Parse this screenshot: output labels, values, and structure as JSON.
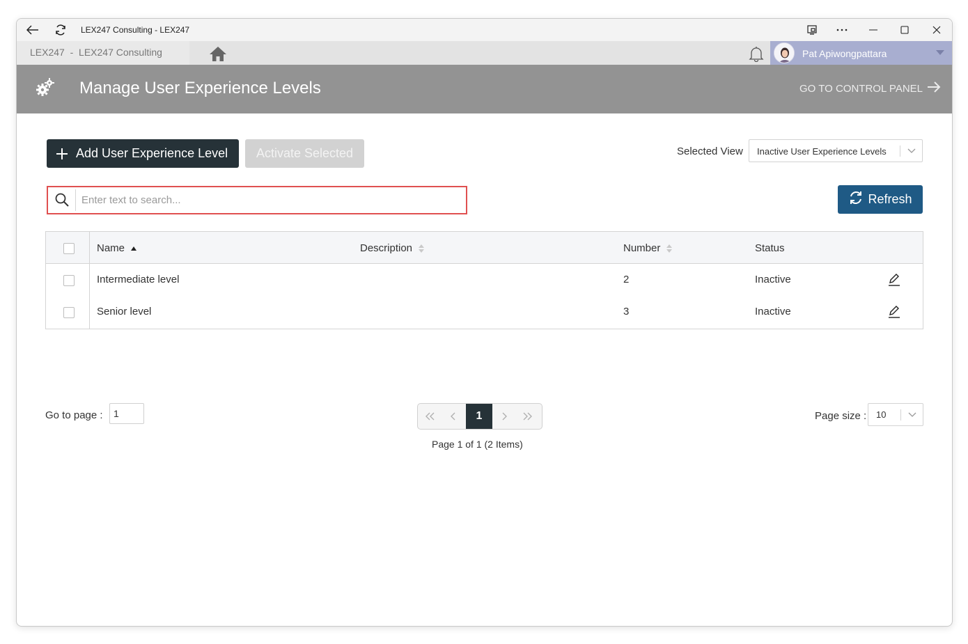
{
  "window": {
    "title": "LEX247 Consulting - LEX247",
    "icons": [
      "back-arrow-icon",
      "refresh-icon",
      "cast-icon",
      "more-icon",
      "minimize-icon",
      "maximize-icon",
      "close-icon"
    ]
  },
  "appbar": {
    "breadcrumb": "LEX247  -  LEX247 Consulting",
    "home_icon": "home-icon",
    "notifications_icon": "bell-icon",
    "user_name": "Pat Apiwongpattara",
    "user_area_color": "#a8aed0"
  },
  "header": {
    "title": "Manage User Experience Levels",
    "control_panel_link": "GO TO CONTROL PANEL",
    "background_color": "#939393"
  },
  "toolbar": {
    "add_label": "Add User Experience Level",
    "activate_label": "Activate Selected",
    "selected_view_label": "Selected View",
    "selected_view_value": "Inactive User Experience Levels",
    "refresh_label": "Refresh",
    "add_button_color": "#263238",
    "refresh_button_color": "#1f5a85"
  },
  "search": {
    "placeholder": "Enter text to search..."
  },
  "table": {
    "columns": [
      "Name",
      "Description",
      "Number",
      "Status"
    ],
    "rows": [
      {
        "name": "Intermediate level",
        "description": "",
        "number": "2",
        "status": "Inactive"
      },
      {
        "name": "Senior level",
        "description": "",
        "number": "3",
        "status": "Inactive"
      }
    ]
  },
  "pager": {
    "goto_label": "Go to page :",
    "goto_value": "1",
    "current_page": "1",
    "info": "Page 1 of 1 (2 Items)",
    "page_size_label": "Page size :",
    "page_size_value": "10"
  }
}
